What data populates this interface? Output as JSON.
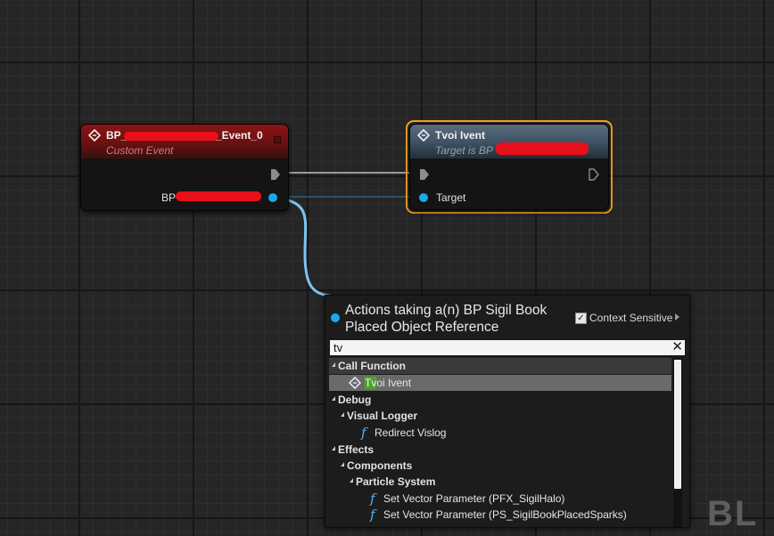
{
  "nodes": {
    "event": {
      "title_prefix": "BP_",
      "title_suffix": "_Event_0",
      "subtitle": "Custom Event",
      "pin_label": "BP",
      "head_color": "#8c1414"
    },
    "function": {
      "title": "Tvoi Ivent",
      "subtitle": "Target is BP",
      "pin_label": "Target",
      "selection_color": "#f5a623"
    }
  },
  "wire_color": "#7cc4f2",
  "menu": {
    "title": "Actions taking a(n) BP Sigil Book Placed Object Reference",
    "context_sensitive_label": "Context Sensitive",
    "context_sensitive_checked": true,
    "search_value": "tv",
    "clear_icon": "✕",
    "tree": [
      {
        "label": "Call Function",
        "kind": "category",
        "level": 0
      },
      {
        "label": "Tvoi Ivent",
        "highlight": "Tv",
        "rest": "oi Ivent",
        "kind": "event",
        "level": 1,
        "selected": true
      },
      {
        "label": "Debug",
        "kind": "category",
        "level": 0
      },
      {
        "label": "Visual Logger",
        "kind": "category",
        "level": 1
      },
      {
        "label": "Redirect Vislog",
        "kind": "function",
        "level": 2
      },
      {
        "label": "Effects",
        "kind": "category",
        "level": 0
      },
      {
        "label": "Components",
        "kind": "category",
        "level": 1
      },
      {
        "label": "Particle System",
        "kind": "category",
        "level": 2
      },
      {
        "label": "Set Vector Parameter (PFX_SigilHalo)",
        "kind": "function",
        "level": 3
      },
      {
        "label": "Set Vector Parameter (PS_SigilBookPlacedSparks)",
        "kind": "function",
        "level": 3
      }
    ]
  },
  "watermark": "BL"
}
